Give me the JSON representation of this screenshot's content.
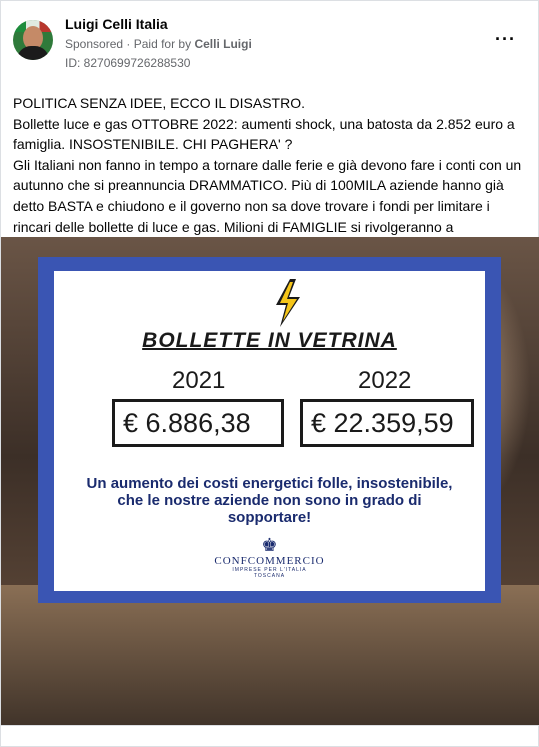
{
  "post": {
    "page_name": "Luigi Celli Italia",
    "sponsored": "Sponsored",
    "paid_for_prefix": "· Paid for by",
    "paid_for_name": "Celli Luigi",
    "ad_id": "ID: 8270699726288530",
    "more_label": "···"
  },
  "body": {
    "line1": "POLITICA SENZA IDEE, ECCO IL DISASTRO.",
    "line2": "Bollette luce e gas OTTOBRE 2022: aumenti shock, una batosta da 2.852 euro a famiglia. INSOSTENIBILE. CHI PAGHERA' ?",
    "line3": "Gli Italiani non fanno in tempo a tornare dalle ferie e già devono fare i conti con un autunno che si preannuncia DRAMMATICO. Più di 100MILA aziende hanno già detto BASTA e chiudono e il governo non sa dove trovare i fondi per limitare i rincari delle bollette di luce e gas. Milioni di FAMIGLIE si rivolgeranno a finanziarie..."
  },
  "sign": {
    "title": "BOLLETTE IN VETRINA",
    "year1": "2021",
    "year2": "2022",
    "amount1": "€ 6.886,38",
    "amount2": "€ 22.359,59",
    "message": "Un aumento dei costi energetici folle, insostenibile, che le nostre aziende non sono in grado di sopportare!",
    "logo_name": "CONFCOMMERCIO",
    "logo_sub": "IMPRESE PER L'ITALIA",
    "logo_region": "TOSCANA"
  },
  "colors": {
    "sign_border": "#3a55b3",
    "sign_text": "#1a2b6e",
    "bolt_yellow": "#f5c518"
  }
}
